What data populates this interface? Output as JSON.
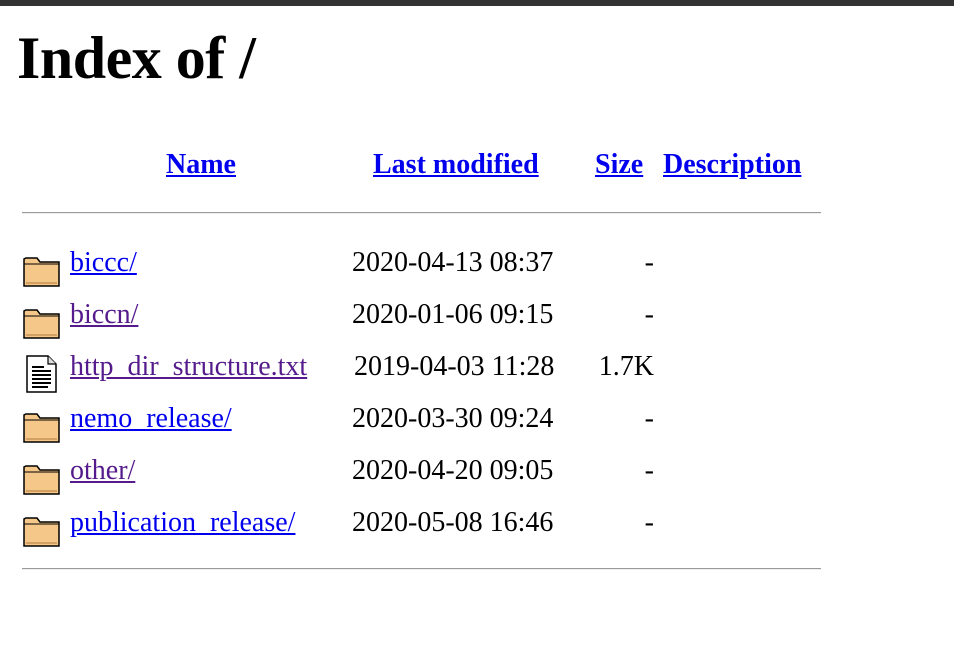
{
  "page": {
    "title": "Index of /"
  },
  "table": {
    "columns": {
      "name": "Name",
      "last_modified": "Last modified",
      "size": "Size",
      "description": "Description"
    },
    "rows": [
      {
        "icon": "folder-icon",
        "name": "biccc/",
        "last_modified": "2020-04-13 08:37",
        "size": "-",
        "description": "",
        "visited": false
      },
      {
        "icon": "folder-icon",
        "name": "biccn/",
        "last_modified": "2020-01-06 09:15",
        "size": "-",
        "description": "",
        "visited": true
      },
      {
        "icon": "text-file-icon",
        "name": "http_dir_structure.txt",
        "last_modified": "2019-04-03 11:28",
        "size": "1.7K",
        "description": "",
        "visited": true
      },
      {
        "icon": "folder-icon",
        "name": "nemo_release/",
        "last_modified": "2020-03-30 09:24",
        "size": "-",
        "description": "",
        "visited": false
      },
      {
        "icon": "folder-icon",
        "name": "other/",
        "last_modified": "2020-04-20 09:05",
        "size": "-",
        "description": "",
        "visited": true
      },
      {
        "icon": "folder-icon",
        "name": "publication_release/",
        "last_modified": "2020-05-08 16:46",
        "size": "-",
        "description": "",
        "visited": false
      }
    ]
  },
  "colors": {
    "link": "#0000ee",
    "visited_link": "#551a8b",
    "top_bar": "#333333",
    "folder_fill": "#f5c88a"
  }
}
